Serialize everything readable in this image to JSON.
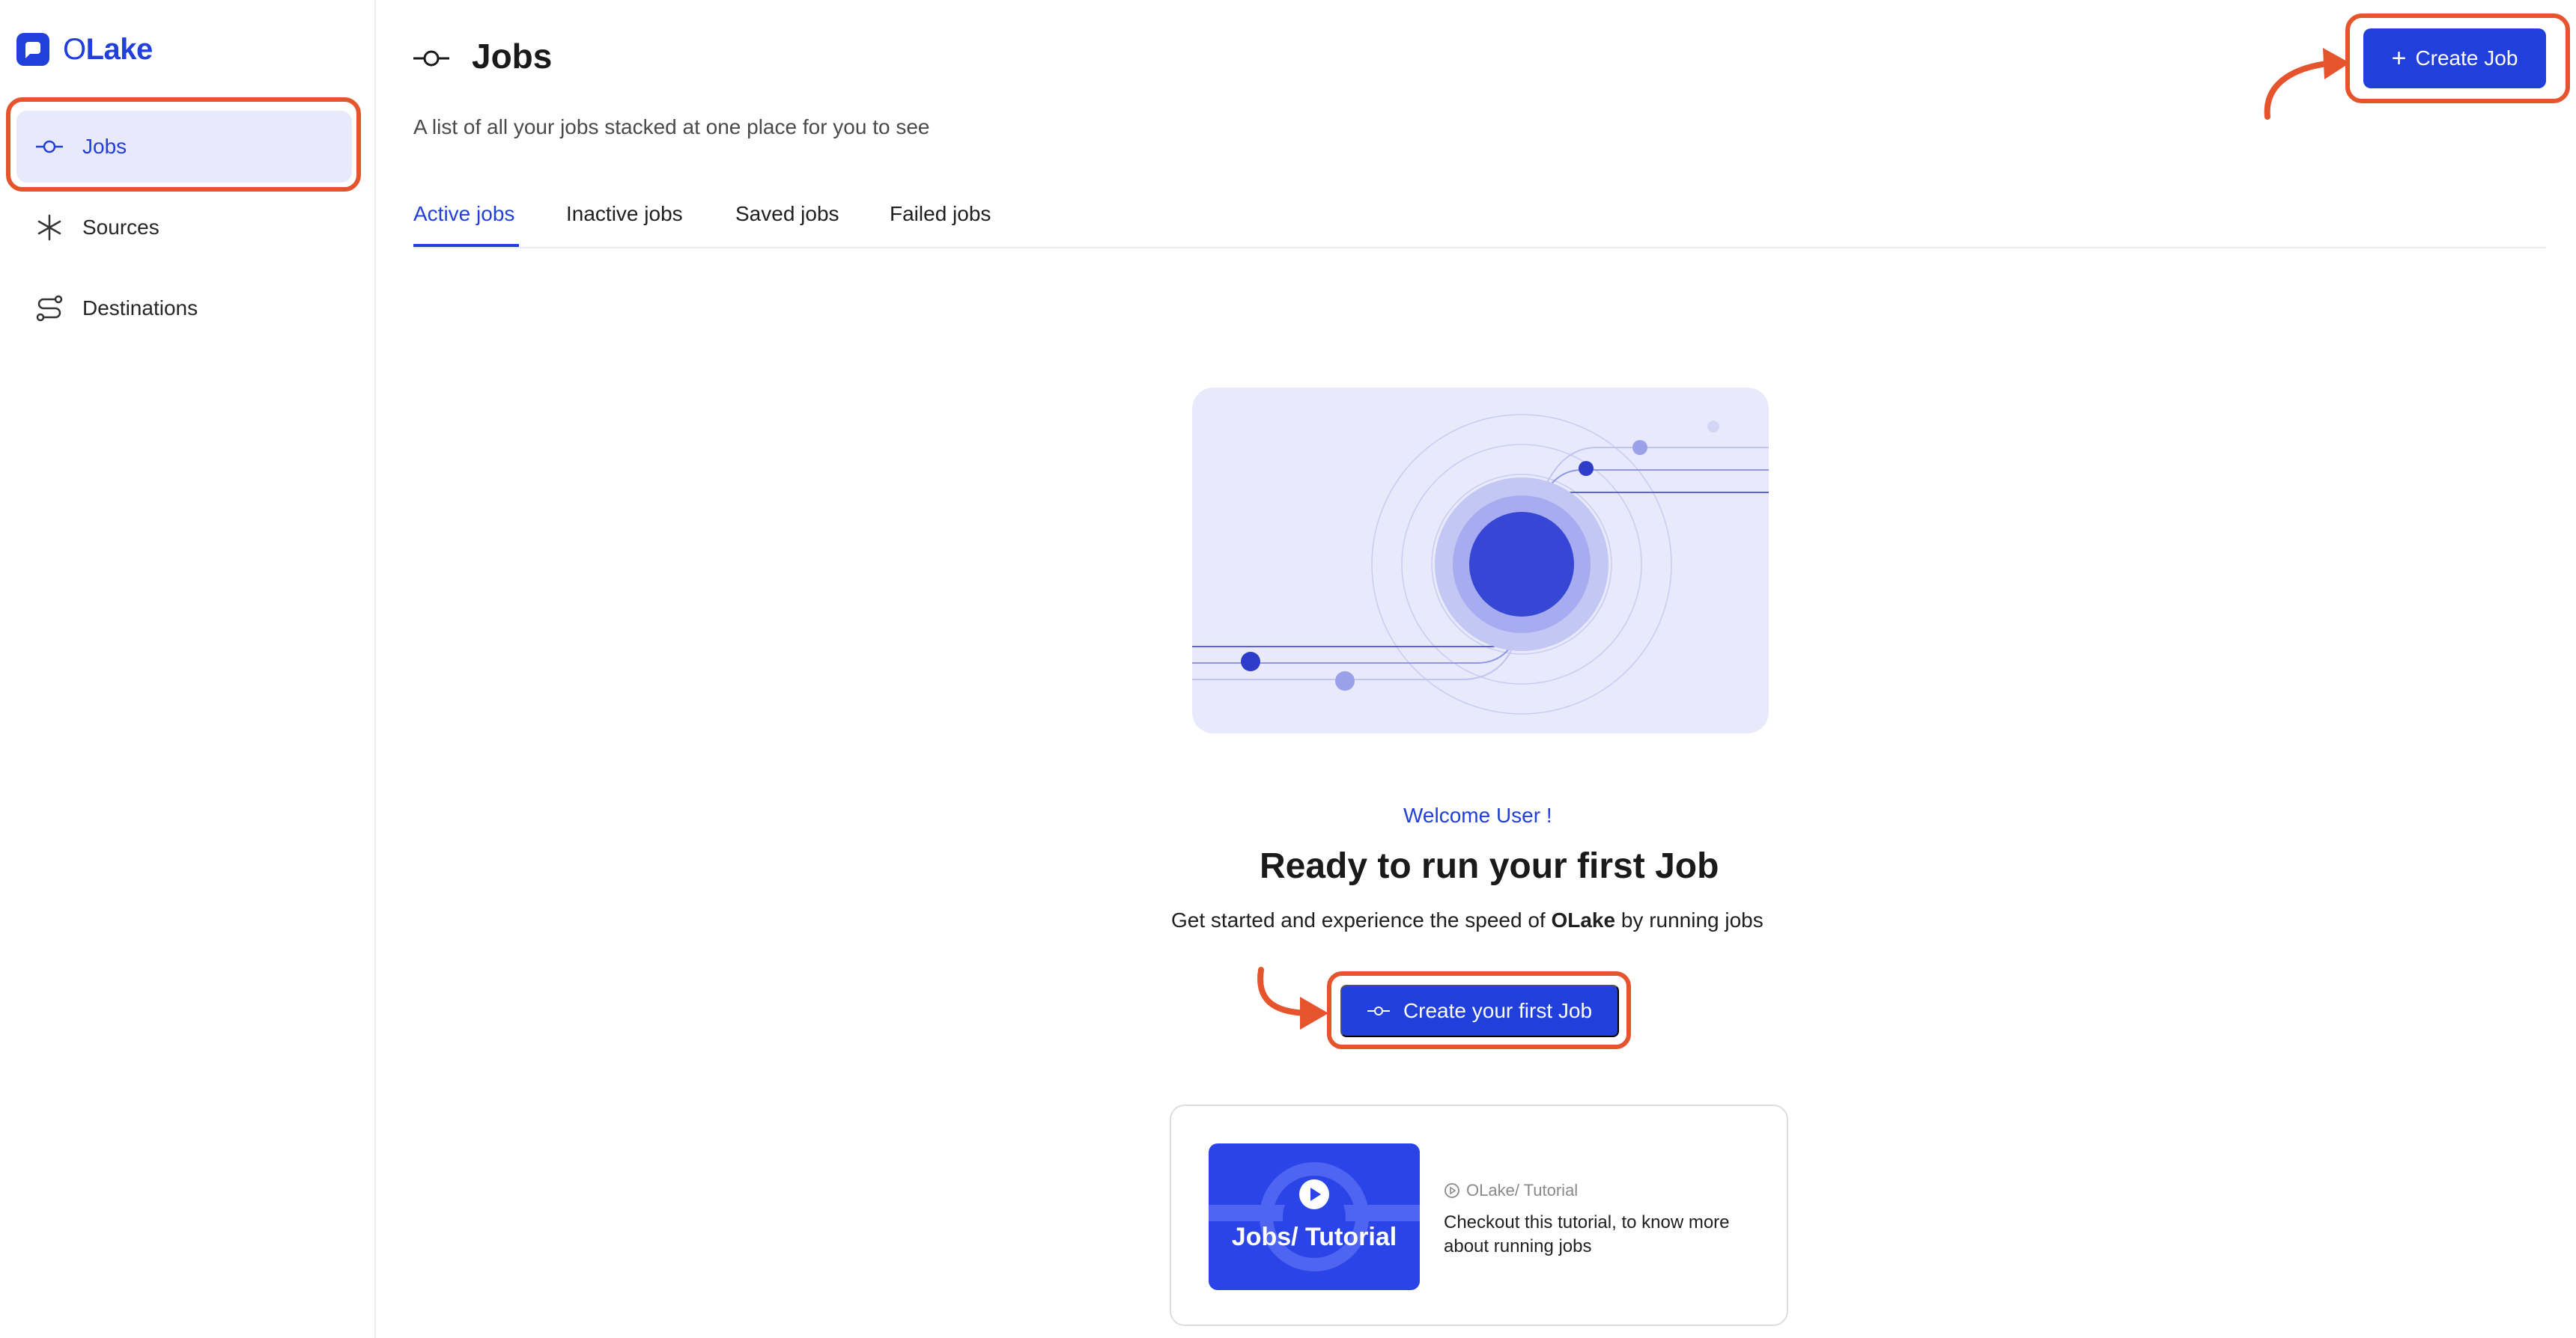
{
  "brand": {
    "name_prefix": "O",
    "name_suffix": "Lake",
    "accent": "#203fdb",
    "highlight": "#e6542d"
  },
  "sidebar": {
    "items": [
      {
        "label": "Jobs",
        "icon": "commit-icon",
        "active": true
      },
      {
        "label": "Sources",
        "icon": "asterisk-icon",
        "active": false
      },
      {
        "label": "Destinations",
        "icon": "route-icon",
        "active": false
      }
    ]
  },
  "header": {
    "title": "Jobs",
    "subtitle": "A list of all your jobs stacked at one place for you to see",
    "create_label": "Create Job"
  },
  "tabs": [
    {
      "label": "Active jobs",
      "active": true
    },
    {
      "label": "Inactive jobs",
      "active": false
    },
    {
      "label": "Saved jobs",
      "active": false
    },
    {
      "label": "Failed jobs",
      "active": false
    }
  ],
  "empty_state": {
    "welcome": "Welcome User !",
    "heading": "Ready to run your first Job",
    "description_before": "Get started and experience the speed of ",
    "description_brand_o": "O",
    "description_brand_rest": "Lake",
    "description_after": " by running jobs",
    "cta_label": "Create your first Job"
  },
  "tutorial": {
    "thumb_label": "Jobs/ Tutorial",
    "meta": "OLake/ Tutorial",
    "description": "Checkout this tutorial, to know more about running jobs"
  }
}
